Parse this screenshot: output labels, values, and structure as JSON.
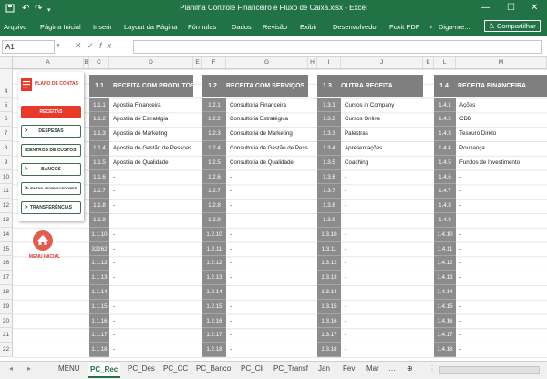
{
  "window": {
    "title": "Planilha Controle Financeiro e Fluxo de Caixa.xlsx - Excel",
    "qa_icons": [
      "save-icon",
      "undo-icon",
      "redo-icon",
      "dropdown-icon"
    ],
    "minimize": "—",
    "maximize": "☐",
    "close": "✕"
  },
  "ribbon": {
    "tabs": [
      "Arquivo",
      "Página Inicial",
      "Inserir",
      "Layout da Página",
      "Fórmulas",
      "Dados",
      "Revisão",
      "Exibir",
      "Desenvolvedor",
      "Foxit PDF"
    ],
    "tell_me": "Diga-me...",
    "share": "Compartilhar"
  },
  "formula_bar": {
    "name_box": "A1",
    "formula": ""
  },
  "columns": [
    "A",
    "B",
    "C",
    "D",
    "E",
    "F",
    "G",
    "H",
    "I",
    "J",
    "K",
    "L",
    "M"
  ],
  "rows": [
    "4",
    "5",
    "6",
    "7",
    "8",
    "9",
    "10",
    "11",
    "12",
    "13",
    "14",
    "15",
    "16",
    "17",
    "18",
    "19",
    "20",
    "21",
    "22"
  ],
  "nav": {
    "logo": "PLANO DE CONTAS",
    "buttons": [
      "RECEITAS",
      "DESPESAS",
      "CENTROS DE CUSTOS",
      "BANCOS",
      "CLIENTES / FORNECEDORES",
      "TRANSFERÊNCIAS"
    ],
    "active": "RECEITAS",
    "home_label": "MENU INICIAL"
  },
  "blocks": [
    {
      "num": "1.1",
      "title": "RECEITA COM PRODUTOS",
      "codes": [
        "1.1.1",
        "1.1.2",
        "1.1.3",
        "1.1.4",
        "1.1.5",
        "1.1.6",
        "1.1.7",
        "1.1.8",
        "1.1.9",
        "1.1.10",
        "32262",
        "1.1.12",
        "1.1.13",
        "1.1.14",
        "1.1.15",
        "1.1.16",
        "1.1.17",
        "1.1.18"
      ],
      "names": [
        "Apostila Financeira",
        "Apostila de Estratégia",
        "Apostila de Marketing",
        "Apostila de Gestão de Pessoas",
        "Apostila de Qualidade",
        "-",
        "-",
        "-",
        "-",
        "-",
        "-",
        "-",
        "-",
        "-",
        "-",
        "-",
        "-",
        "-"
      ]
    },
    {
      "num": "1.2",
      "title": "RECEITA COM SERVIÇOS",
      "codes": [
        "1.2.1",
        "1.2.2",
        "1.2.3",
        "1.2.4",
        "1.2.5",
        "1.2.6",
        "1.2.7",
        "1.2.8",
        "1.2.9",
        "1.2.10",
        "1.2.11",
        "1.2.12",
        "1.2.13",
        "1.2.14",
        "1.2.15",
        "1.2.16",
        "1.2.17",
        "1.2.18"
      ],
      "names": [
        "Consultoria Financeira",
        "Consultoria Estratégica",
        "Consultoria de Marketing",
        "Consultoria de Gestão de Pessoas",
        "Consultoria de Qualidade",
        "-",
        "-",
        "-",
        "-",
        "-",
        "-",
        "-",
        "-",
        "-",
        "-",
        "-",
        "-",
        "-"
      ]
    },
    {
      "num": "1.3",
      "title": "OUTRA RECEITA",
      "codes": [
        "1.3.1",
        "1.3.2",
        "1.3.3",
        "1.3.4",
        "1.3.5",
        "1.3.6",
        "1.3.7",
        "1.3.8",
        "1.3.9",
        "1.3.10",
        "1.3.11",
        "1.3.12",
        "1.3.13",
        "1.3.14",
        "1.3.15",
        "1.3.16",
        "1.3.17",
        "1.3.18"
      ],
      "names": [
        "Cursos in Company",
        "Cursos Online",
        "Palestras",
        "Apresentações",
        "Coaching",
        "-",
        "-",
        "-",
        "-",
        "-",
        "-",
        "-",
        "-",
        "-",
        "-",
        "-",
        "-",
        "-"
      ]
    },
    {
      "num": "1.4",
      "title": "RECEITA FINANCEIRA",
      "codes": [
        "1.4.1",
        "1.4.2",
        "1.4.3",
        "1.4.4",
        "1.4.5",
        "1.4.6",
        "1.4.7",
        "1.4.8",
        "1.4.9",
        "1.4.10",
        "1.4.11",
        "1.4.12",
        "1.4.13",
        "1.4.14",
        "1.4.15",
        "1.4.16",
        "1.4.17",
        "1.4.18"
      ],
      "names": [
        "Ações",
        "CDB",
        "Tesouro Direto",
        "Poupança",
        "Fundos de Investimento",
        "-",
        "-",
        "-",
        "-",
        "-",
        "-",
        "-",
        "-",
        "-",
        "-",
        "-",
        "-",
        "-"
      ]
    }
  ],
  "sheet_tabs": [
    "MENU",
    "PC_Rec",
    "PC_Des",
    "PC_CC",
    "PC_Banco",
    "PC_Cli",
    "PC_Transf",
    "Jan",
    "Fev",
    "Mar"
  ],
  "active_sheet": "PC_Rec",
  "colors": {
    "excel_green": "#217346",
    "accent_red": "#e8392a",
    "header_gray": "#7f7f7f",
    "code_gray": "#8c8c8c"
  }
}
